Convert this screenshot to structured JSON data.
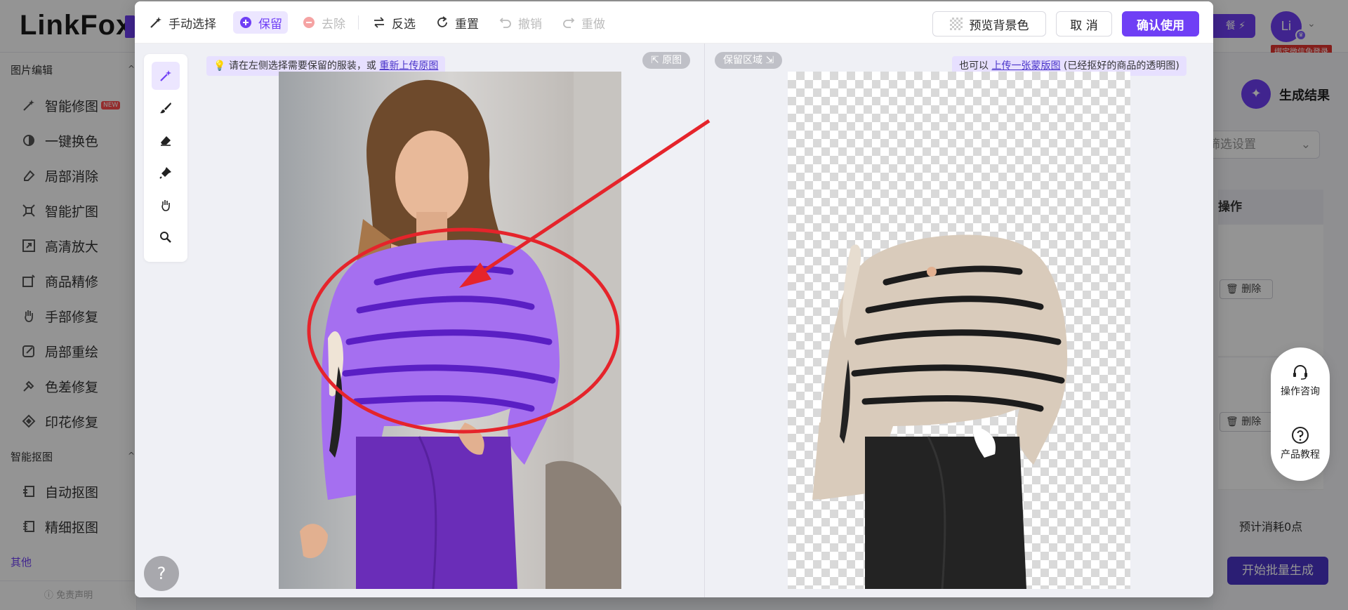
{
  "background": {
    "logo": "LinkFox",
    "plan_button": "餐",
    "avatar_initial": "Li",
    "bind_tag": "绑定微信免登录",
    "sidebar": {
      "section_image_edit": "图片编辑",
      "items_edit": [
        {
          "label": "智能修图",
          "icon": "magic-wand-icon",
          "badge": "NEW"
        },
        {
          "label": "一键换色",
          "icon": "color-swap-icon"
        },
        {
          "label": "局部消除",
          "icon": "eraser-icon"
        },
        {
          "label": "智能扩图",
          "icon": "expand-icon"
        },
        {
          "label": "高清放大",
          "icon": "upscale-icon"
        },
        {
          "label": "商品精修",
          "icon": "product-retouch-icon"
        },
        {
          "label": "手部修复",
          "icon": "hand-icon"
        },
        {
          "label": "局部重绘",
          "icon": "repaint-icon"
        },
        {
          "label": "色差修复",
          "icon": "color-fix-icon"
        },
        {
          "label": "印花修复",
          "icon": "print-fix-icon"
        }
      ],
      "section_cutout": "智能抠图",
      "items_cutout": [
        {
          "label": "自动抠图",
          "icon": "auto-cutout-icon"
        },
        {
          "label": "精细抠图",
          "icon": "fine-cutout-icon"
        }
      ],
      "section_other": "其他",
      "disclaimer": "免责声明"
    },
    "right_panel": {
      "result_title": "生成结果",
      "filter_placeholder": "筛选设置",
      "table_header": "操作",
      "delete_label": "删除",
      "cost_text": "预计消耗0点",
      "start_button": "开始批量生成"
    }
  },
  "help_pill": {
    "consult": "操作咨询",
    "tutorial": "产品教程"
  },
  "toolbar": {
    "manual_select": "手动选择",
    "keep": "保留",
    "remove": "去除",
    "invert": "反选",
    "reset": "重置",
    "undo": "撤销",
    "redo": "重做",
    "preview_bg": "预览背景色",
    "cancel": "取 消",
    "confirm": "确认使用"
  },
  "workspace": {
    "left_hint_prefix": "请在左侧选择需要保留的服装，或 ",
    "left_hint_link": "重新上传原图",
    "original_tag": "原图",
    "keep_area_tag": "保留区域",
    "right_hint_prefix": "也可以 ",
    "right_hint_link": "上传一张蒙版图",
    "right_hint_suffix": " (已经抠好的商品的透明图)",
    "help_symbol": "?"
  },
  "colors": {
    "accent": "#6f3ff5",
    "mask_purple": "#a56ff0",
    "annotation_red": "#e5242b"
  }
}
